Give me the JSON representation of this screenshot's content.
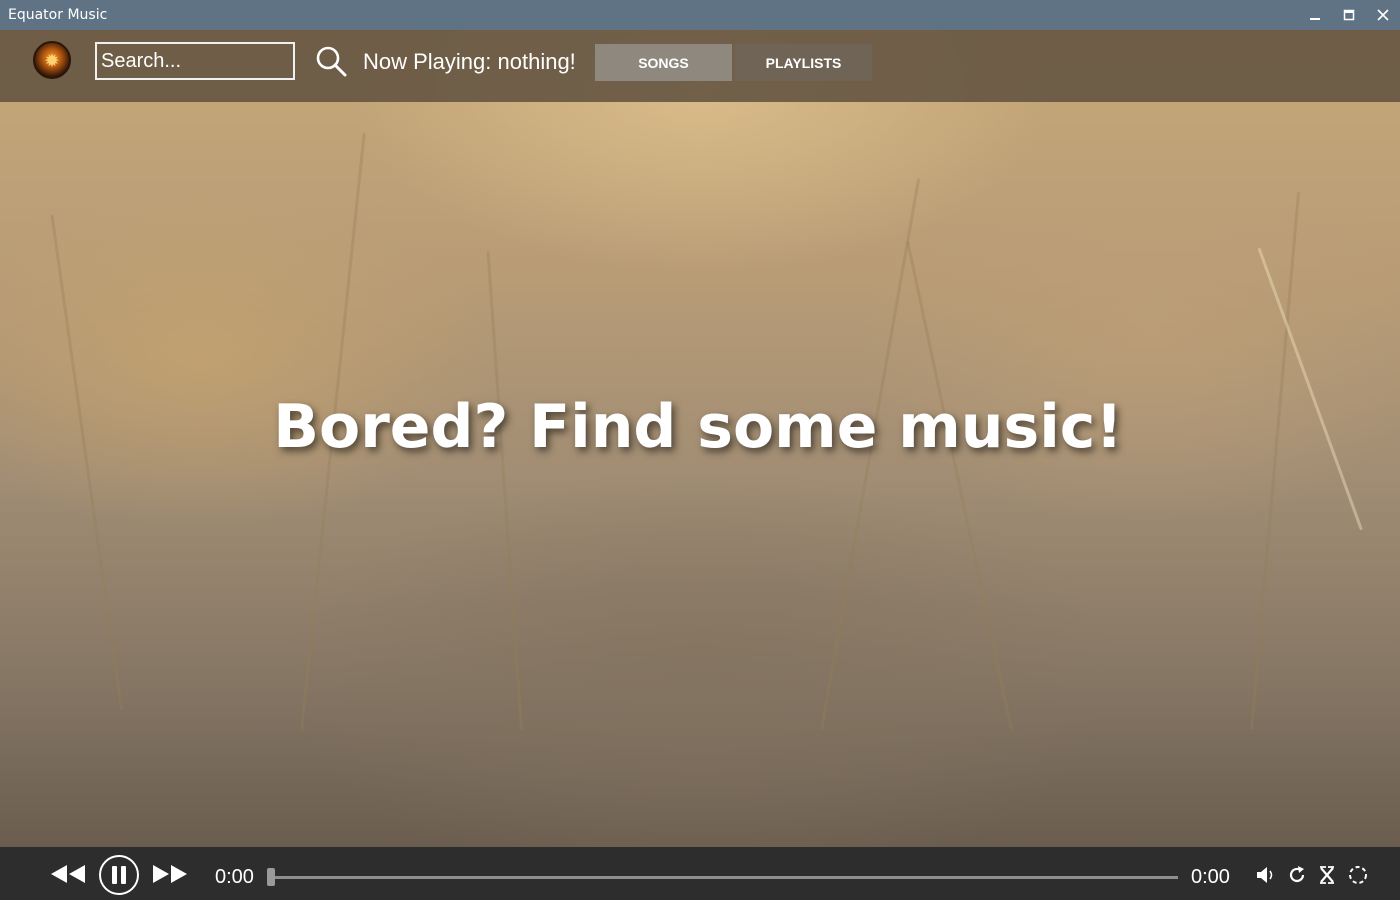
{
  "window": {
    "title": "Equator Music",
    "controls": [
      "minimize-icon",
      "maximize-icon",
      "close-icon"
    ]
  },
  "header": {
    "search_placeholder": "Search...",
    "now_playing": "Now Playing: nothing!",
    "tabs": [
      {
        "label": "SONGS",
        "active": true
      },
      {
        "label": "PLAYLISTS",
        "active": false
      }
    ]
  },
  "main": {
    "message": "Bored? Find some music!"
  },
  "player": {
    "elapsed": "0:00",
    "total": "0:00",
    "progress": 0,
    "controls": [
      "rewind-icon",
      "pause-icon",
      "fast-forward-icon"
    ],
    "extra_controls": [
      "volume-icon",
      "repeat-icon",
      "shuffle-icon",
      "fullscreen-icon"
    ]
  },
  "colors": {
    "titlebar": "#5f7385",
    "topbar": "#5f503e",
    "tab_active": "#8f887e",
    "tab_inactive": "#6f6455",
    "playerbar": "#2d2d2d"
  }
}
